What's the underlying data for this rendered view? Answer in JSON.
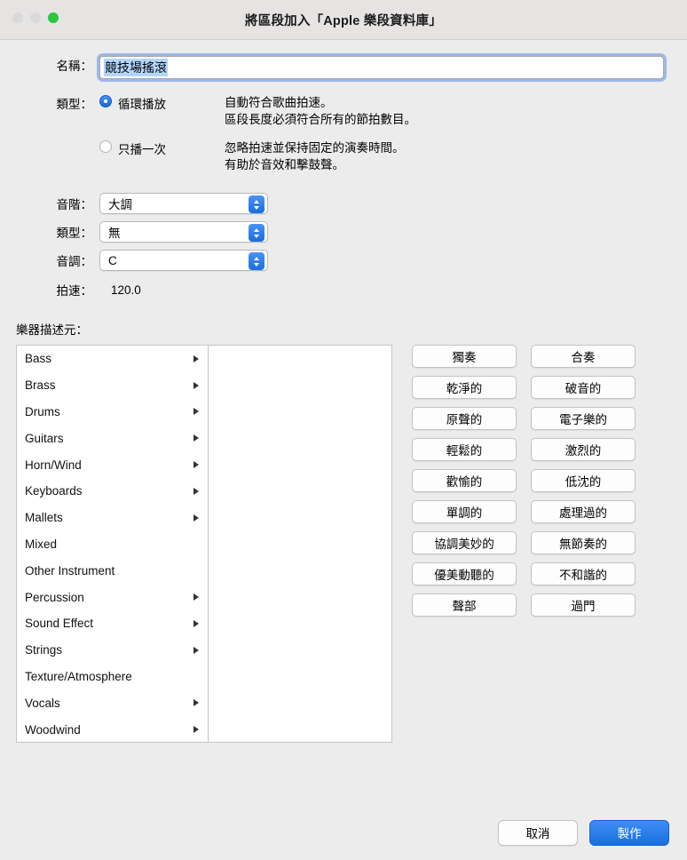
{
  "window": {
    "title": "將區段加入「Apple 樂段資料庫」",
    "traffic_lights": [
      "close",
      "minimize",
      "zoom"
    ]
  },
  "form": {
    "name_label": "名稱：",
    "name_value": "競技場搖滾",
    "type_label": "類型：",
    "loop_option": "循環播放",
    "loop_desc_line1": "自動符合歌曲拍速。",
    "loop_desc_line2": "區段長度必須符合所有的節拍數目。",
    "oneshot_option": "只播一次",
    "oneshot_desc_line1": "忽略拍速並保持固定的演奏時間。",
    "oneshot_desc_line2": "有助於音效和擊鼓聲。",
    "selected_playback": "循環播放"
  },
  "popups": [
    {
      "label": "音階：",
      "value": "大調"
    },
    {
      "label": "類型：",
      "value": "無"
    },
    {
      "label": "音調：",
      "value": "C"
    }
  ],
  "tempo": {
    "label": "拍速：",
    "value": "120.0"
  },
  "descriptors": {
    "title": "樂器描述元：",
    "categories": [
      {
        "label": "Bass",
        "has_submenu": true
      },
      {
        "label": "Brass",
        "has_submenu": true
      },
      {
        "label": "Drums",
        "has_submenu": true
      },
      {
        "label": "Guitars",
        "has_submenu": true
      },
      {
        "label": "Horn/Wind",
        "has_submenu": true
      },
      {
        "label": "Keyboards",
        "has_submenu": true
      },
      {
        "label": "Mallets",
        "has_submenu": true
      },
      {
        "label": "Mixed",
        "has_submenu": false
      },
      {
        "label": "Other Instrument",
        "has_submenu": false
      },
      {
        "label": "Percussion",
        "has_submenu": true
      },
      {
        "label": "Sound Effect",
        "has_submenu": true
      },
      {
        "label": "Strings",
        "has_submenu": true
      },
      {
        "label": "Texture/Atmosphere",
        "has_submenu": false
      },
      {
        "label": "Vocals",
        "has_submenu": true
      },
      {
        "label": "Woodwind",
        "has_submenu": true
      }
    ]
  },
  "tags": [
    "獨奏",
    "合奏",
    "乾淨的",
    "破音的",
    "原聲的",
    "電子樂的",
    "輕鬆的",
    "激烈的",
    "歡愉的",
    "低沈的",
    "單調的",
    "處理過的",
    "協調美妙的",
    "無節奏的",
    "優美動聽的",
    "不和諧的",
    "聲部",
    "過門"
  ],
  "footer": {
    "cancel_label": "取消",
    "create_label": "製作"
  },
  "colors": {
    "accent": "#1a6ddb",
    "selection": "#b4d5fe",
    "window_bg": "#ececec"
  }
}
